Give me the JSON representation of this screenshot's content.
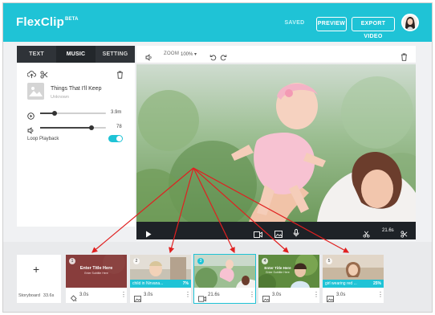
{
  "header": {
    "logo_text": "FlexClip",
    "logo_badge": "BETA",
    "saved_label": "SAVED",
    "preview_label": "PREVIEW",
    "export_label": "EXPORT VIDEO",
    "brand_color": "#1fc3d6"
  },
  "left_panel": {
    "tabs": [
      {
        "label": "TEXT",
        "active": false
      },
      {
        "label": "MUSIC",
        "active": true
      },
      {
        "label": "SETTING",
        "active": false
      }
    ],
    "song_title": "Things That I'll Keep",
    "song_artist": "Unknown",
    "playback_value": "3.9m",
    "playback_level": 0.22,
    "volume_value": "78",
    "volume_level": 0.78,
    "loop_label": "Loop Playback",
    "loop_on": true
  },
  "toolbar": {
    "zoom_label": "ZOOM",
    "zoom_value": "100%",
    "zoom_caret": "▾"
  },
  "player": {
    "duration": "21.6s"
  },
  "storyboard": {
    "label": "Storyboard",
    "total_duration": "33.6s",
    "add_symbol": "+",
    "clips": [
      {
        "number": "1",
        "duration": "3.0s",
        "title_text": "Enter Title Here",
        "subtitle_text": "Enter Subtitle Here",
        "caption": "",
        "percent": "",
        "selected": false,
        "icon": "paint-bucket-icon"
      },
      {
        "number": "2",
        "duration": "3.0s",
        "title_text": "",
        "subtitle_text": "",
        "caption": "child in Nirvana...",
        "percent": "7%",
        "selected": false,
        "icon": "image-icon"
      },
      {
        "number": "3",
        "duration": "21.6s",
        "title_text": "",
        "subtitle_text": "",
        "caption": "",
        "percent": "",
        "selected": true,
        "icon": "video-icon"
      },
      {
        "number": "4",
        "duration": "3.0s",
        "title_text": "Enter Title Here",
        "subtitle_text": "Enter Subtitle Here",
        "caption": "",
        "percent": "",
        "selected": false,
        "icon": "image-icon"
      },
      {
        "number": "5",
        "duration": "3.0s",
        "title_text": "",
        "subtitle_text": "",
        "caption": "girl wearing red ...",
        "percent": "25%",
        "selected": false,
        "icon": "image-icon"
      }
    ],
    "more_symbol": "⋮"
  }
}
